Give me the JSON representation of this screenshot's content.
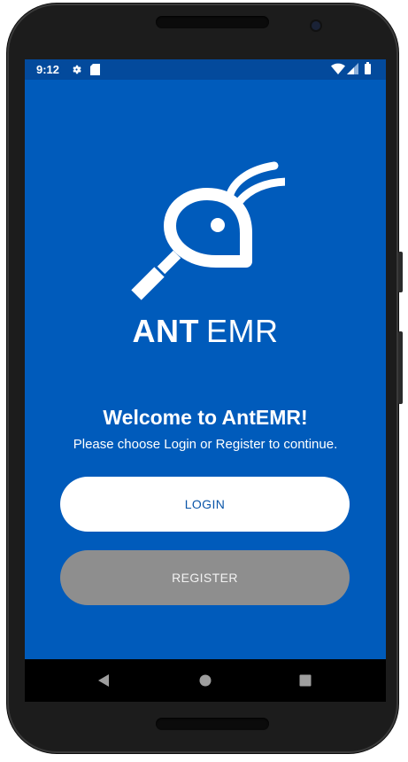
{
  "status_bar": {
    "time": "9:12",
    "icons": [
      "settings-gear-icon",
      "sd-card-icon",
      "wifi-icon",
      "cell-signal-icon",
      "battery-icon"
    ]
  },
  "brand": {
    "name_bold": "ANT",
    "name_light": "EMR",
    "logo_icon": "ant-magnifier-logo-icon"
  },
  "welcome": {
    "title": "Welcome to AntEMR!",
    "subtitle": "Please choose Login or Register to continue."
  },
  "buttons": {
    "login_label": "LOGIN",
    "register_label": "REGISTER"
  },
  "nav_bar": {
    "icons": [
      "back-icon",
      "home-icon",
      "recents-icon"
    ]
  },
  "colors": {
    "background": "#005BBB",
    "status_bar": "#034a9c",
    "login_button": "#ffffff",
    "login_text": "#0a55a8",
    "register_button": "#8e8e8e"
  }
}
